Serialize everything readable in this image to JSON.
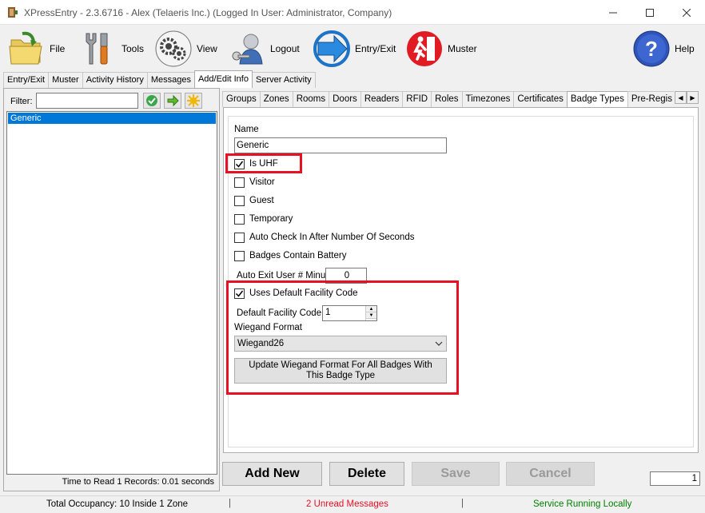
{
  "window": {
    "title": "XPressEntry - 2.3.6716 - Alex (Telaeris Inc.) (Logged In User: Administrator, Company)"
  },
  "toolbar": {
    "file": "File",
    "tools": "Tools",
    "view": "View",
    "logout": "Logout",
    "entry_exit": "Entry/Exit",
    "muster": "Muster",
    "help": "Help"
  },
  "main_tabs": [
    "Entry/Exit",
    "Muster",
    "Activity History",
    "Messages",
    "Add/Edit Info",
    "Server Activity"
  ],
  "left": {
    "filter_label": "Filter:",
    "filter_value": "",
    "items": [
      "Generic"
    ],
    "records_text": "Time to Read 1 Records: 0.01 seconds"
  },
  "sub_tabs": [
    "Groups",
    "Zones",
    "Rooms",
    "Doors",
    "Readers",
    "RFID",
    "Roles",
    "Timezones",
    "Certificates",
    "Badge Types",
    "Pre-Regis"
  ],
  "form": {
    "name_label": "Name",
    "name_value": "Generic",
    "is_uhf": {
      "label": "Is UHF",
      "checked": true
    },
    "visitor": {
      "label": "Visitor",
      "checked": false
    },
    "guest": {
      "label": "Guest",
      "checked": false
    },
    "temporary": {
      "label": "Temporary",
      "checked": false
    },
    "auto_check_in": {
      "label": "Auto Check In After Number Of Seconds",
      "checked": false
    },
    "battery": {
      "label": "Badges Contain Battery",
      "checked": false
    },
    "auto_exit_label": "Auto Exit User # Minutes",
    "auto_exit_value": "0",
    "uses_default_fc": {
      "label": "Uses Default Facility Code",
      "checked": true
    },
    "default_fc_label": "Default Facility Code",
    "default_fc_value": "1",
    "wiegand_label": "Wiegand Format",
    "wiegand_value": "Wiegand26",
    "update_button": "Update Wiegand Format For All Badges With This Badge Type"
  },
  "buttons": {
    "add_new": "Add New",
    "delete": "Delete",
    "save": "Save",
    "cancel": "Cancel"
  },
  "page_value": "1",
  "status": {
    "occupancy": "Total Occupancy: 10 Inside 1 Zone",
    "sep": "|",
    "unread": "2 Unread Messages",
    "service": "Service Running Locally"
  },
  "colors": {
    "highlight": "#e81123",
    "unread": "#e81123",
    "service": "#008000",
    "selection": "#0078d7"
  }
}
